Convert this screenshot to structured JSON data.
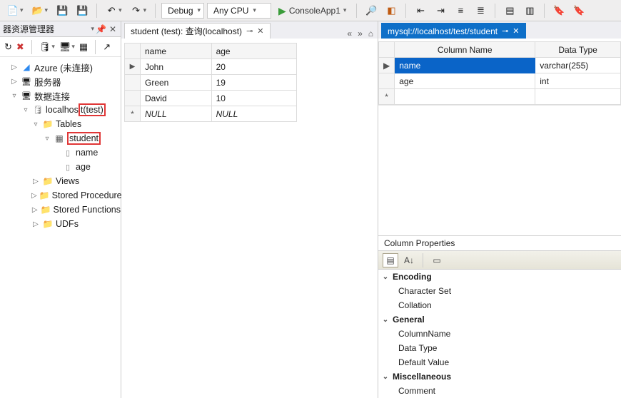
{
  "toolbar": {
    "config": "Debug",
    "platform": "Any CPU",
    "start_label": "ConsoleApp1"
  },
  "left_panel": {
    "title": "器资源管理器",
    "tree": {
      "azure": "Azure (未连接)",
      "servers": "服务器",
      "data_conn": "数据连接",
      "localhost": "localhos",
      "localhost_suffix": "t(test)",
      "tables": "Tables",
      "student": "student",
      "col_name": "name",
      "col_age": "age",
      "views": "Views",
      "sp": "Stored Procedure",
      "sf": "Stored Functions",
      "udfs": "UDFs"
    }
  },
  "middle_tab": "student (test): 查询(localhost)",
  "student_grid": {
    "headers": {
      "name": "name",
      "age": "age"
    },
    "rows": [
      {
        "name": "John",
        "age": "20"
      },
      {
        "name": "Green",
        "age": "19"
      },
      {
        "name": "David",
        "age": "10"
      }
    ],
    "null_label": "NULL"
  },
  "right_tab": "mysql://localhost/test/student",
  "column_grid": {
    "headers": {
      "name": "Column Name",
      "type": "Data Type"
    },
    "rows": [
      {
        "name": "name",
        "type": "varchar(255)",
        "selected": true
      },
      {
        "name": "age",
        "type": "int"
      }
    ]
  },
  "props": {
    "title": "Column Properties",
    "cats": {
      "encoding": "Encoding",
      "charset": "Character Set",
      "collation": "Collation",
      "general": "General",
      "colname": "ColumnName",
      "datatype": "Data Type",
      "defaultv": "Default Value",
      "misc": "Miscellaneous",
      "comment": "Comment"
    }
  }
}
